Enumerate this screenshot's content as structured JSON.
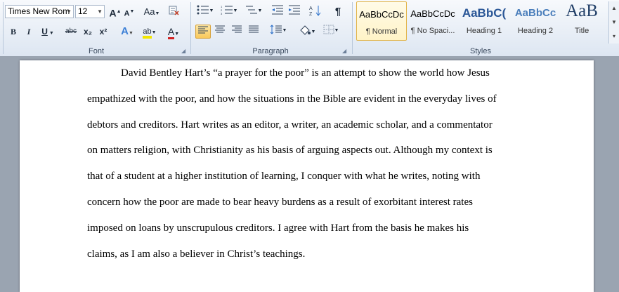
{
  "font": {
    "label": "Font",
    "font_name": "Times New Rom",
    "font_size": "12",
    "buttons": {
      "grow": "A",
      "shrink": "A",
      "change_case": "Aa",
      "bold": "B",
      "italic": "I",
      "underline": "U",
      "strike": "abc",
      "subscript": "x₂",
      "superscript": "x²",
      "effects": "A",
      "highlight": "ab",
      "font_color": "A"
    }
  },
  "paragraph": {
    "label": "Paragraph"
  },
  "styles": {
    "label": "Styles",
    "items": [
      {
        "sample": "AaBbCcDc",
        "name": "¶ Normal"
      },
      {
        "sample": "AaBbCcDc",
        "name": "¶ No Spaci..."
      },
      {
        "sample": "AaBbC(",
        "name": "Heading 1"
      },
      {
        "sample": "AaBbCc",
        "name": "Heading 2"
      },
      {
        "sample": "AaB",
        "name": "Title"
      }
    ]
  },
  "document": {
    "lines": [
      "David Bentley Hart’s “a prayer for the poor” is an attempt to show the world how Jesus",
      "empathized with the poor, and how the situations in the Bible are evident in the everyday lives of",
      "debtors and creditors. Hart writes as an editor, a writer, an academic scholar, and a commentator",
      "on matters religion, with Christianity as his basis of arguing aspects out. Although my context is",
      "that of a student at a higher institution of learning, I conquer with what he writes, noting with",
      "concern how the poor are made to bear heavy burdens as a result of exorbitant interest rates",
      "imposed on loans by unscrupulous creditors. I agree with Hart from the basis he makes his",
      "claims, as I am also a believer in Christ’s teachings."
    ]
  },
  "colors": {
    "highlight": "#f2e600",
    "font_color": "#d02020",
    "effects": "#3b7fd6",
    "heading": "#2b5797"
  }
}
